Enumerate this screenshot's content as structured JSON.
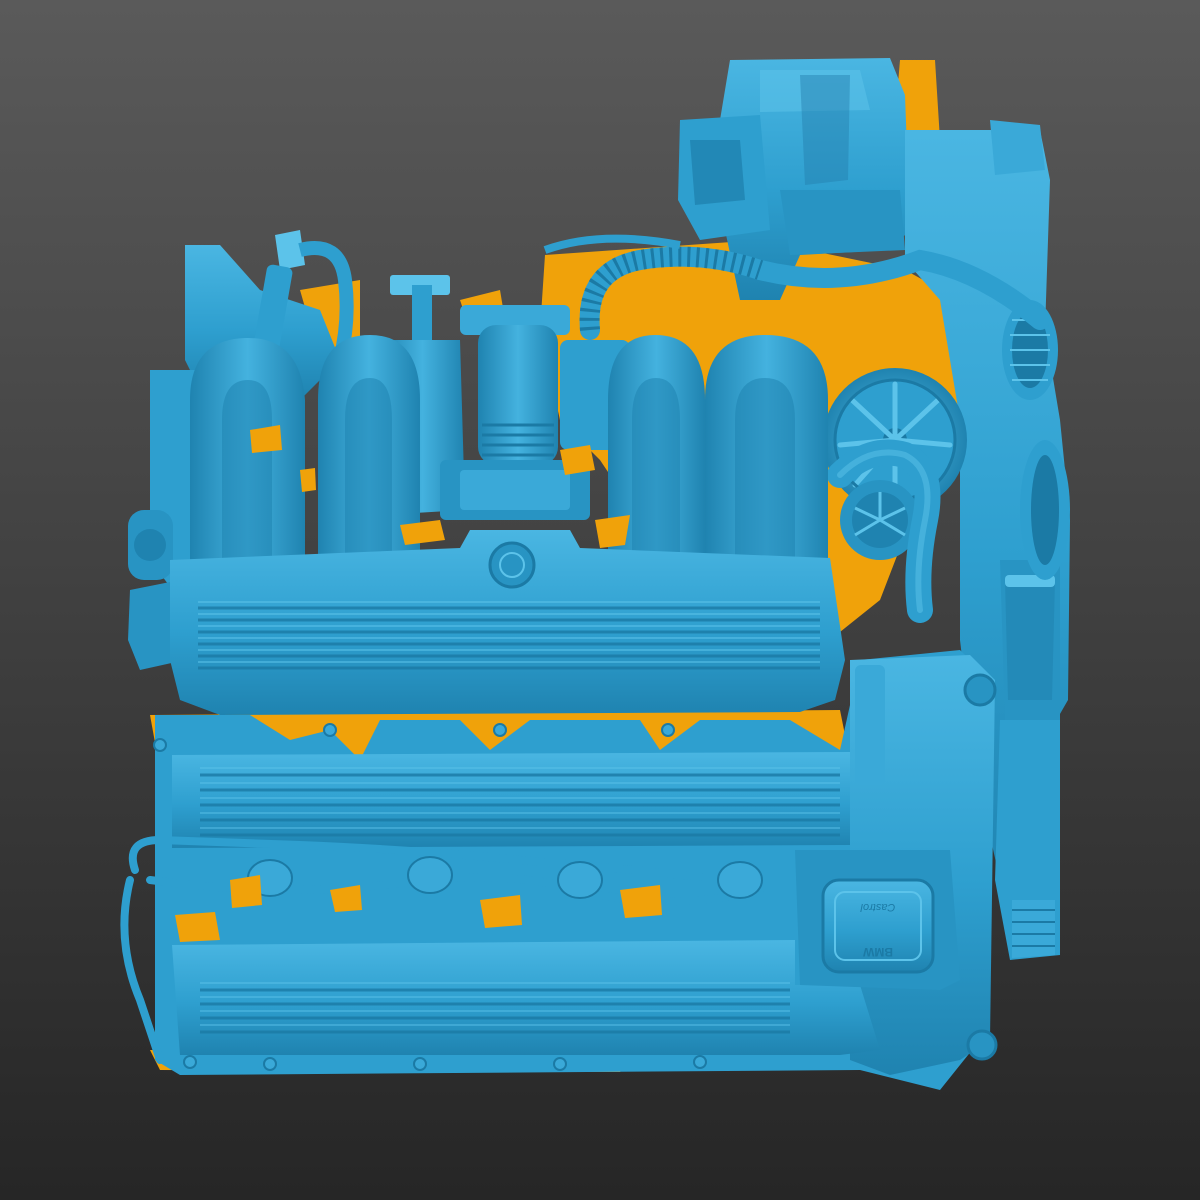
{
  "scene": {
    "background_top": "#5a5a5a",
    "background_bottom": "#262626",
    "model_color": "#2e9fcf",
    "model_shadow": "#1b7aa5",
    "model_highlight": "#5cc3ea",
    "deviation_color": "#f0a20a",
    "icons": [
      "engine-model",
      "alternator",
      "pulley",
      "intake-manifold",
      "valve-cover",
      "oil-cap"
    ]
  },
  "oil_cap": {
    "brand": "BMW",
    "text": "Castrol"
  }
}
